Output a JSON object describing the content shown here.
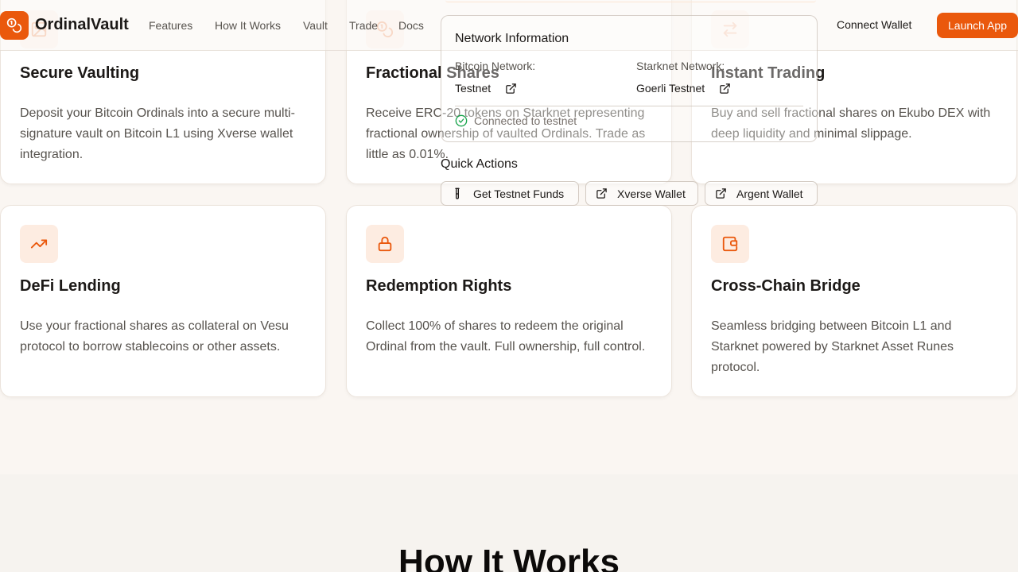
{
  "brand": {
    "name": "OrdinalVault",
    "accent": "#ea580c"
  },
  "nav": {
    "items": [
      "Features",
      "How It Works",
      "Vault",
      "Trade",
      "Docs"
    ],
    "connect_wallet": "Connect Wallet",
    "launch_app": "Launch App"
  },
  "features": [
    {
      "icon": "image-icon",
      "title": "Secure Vaulting",
      "description": "Deposit your Bitcoin Ordinals into a secure multi-signature vault on Bitcoin L1 using Xverse wallet integration."
    },
    {
      "icon": "coins-icon",
      "title": "Fractional Shares",
      "description": "Receive ERC-20 tokens on Starknet representing fractional ownership of vaulted Ordinals. Trade as little as 0.01%."
    },
    {
      "icon": "swap-arrows-icon",
      "title": "Instant Trading",
      "description": "Buy and sell fractional shares on Ekubo DEX with deep liquidity and minimal slippage."
    },
    {
      "icon": "trending-up-icon",
      "title": "DeFi Lending",
      "description": "Use your fractional shares as collateral on Vesu protocol to borrow stablecoins or other assets."
    },
    {
      "icon": "lock-icon",
      "title": "Redemption Rights",
      "description": "Collect 100% of shares to redeem the original Ordinal from the vault. Full ownership, full control."
    },
    {
      "icon": "wallet-icon",
      "title": "Cross-Chain Bridge",
      "description": "Seamless bridging between Bitcoin L1 and Starknet powered by Starknet Asset Runes protocol."
    }
  ],
  "network_popover": {
    "title": "Network Information",
    "bitcoin_label": "Bitcoin Network:",
    "bitcoin_value": "Testnet",
    "starknet_label": "Starknet Network:",
    "starknet_value": "Goerli Testnet",
    "status": "Connected to testnet",
    "status_color": "#16a34a",
    "quick_actions_title": "Quick Actions",
    "actions": [
      "Get Testnet Funds",
      "Xverse Wallet",
      "Argent Wallet"
    ]
  },
  "how_it_works": {
    "title": "How It Works"
  }
}
